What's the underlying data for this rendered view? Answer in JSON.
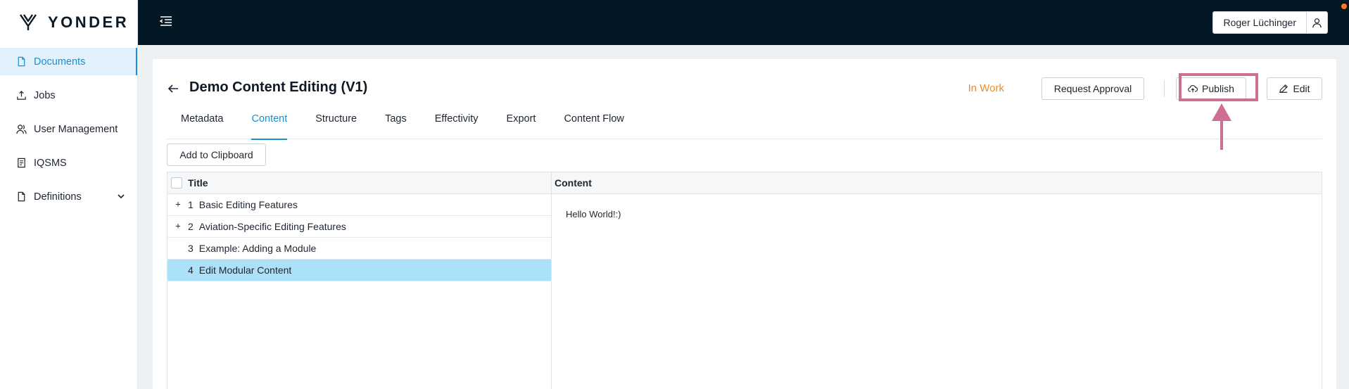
{
  "brand": {
    "name": "YONDER"
  },
  "sidebar": {
    "items": [
      {
        "label": "Documents",
        "icon": "document-icon",
        "active": true
      },
      {
        "label": "Jobs",
        "icon": "upload-icon",
        "active": false
      },
      {
        "label": "User Management",
        "icon": "users-icon",
        "active": false
      },
      {
        "label": "IQSMS",
        "icon": "report-icon",
        "active": false
      },
      {
        "label": "Definitions",
        "icon": "document-icon",
        "active": false,
        "expandable": true
      }
    ]
  },
  "topbar": {
    "user_name": "Roger Lüchinger",
    "notification": true
  },
  "document": {
    "title": "Demo Content Editing (V1)",
    "status": "In Work",
    "request_approval_label": "Request Approval",
    "publish_label": "Publish",
    "edit_label": "Edit"
  },
  "tabs": [
    {
      "label": "Metadata",
      "active": false
    },
    {
      "label": "Content",
      "active": true
    },
    {
      "label": "Structure",
      "active": false
    },
    {
      "label": "Tags",
      "active": false
    },
    {
      "label": "Effectivity",
      "active": false
    },
    {
      "label": "Export",
      "active": false
    },
    {
      "label": "Content Flow",
      "active": false
    }
  ],
  "toolbar": {
    "clipboard_label": "Add to Clipboard"
  },
  "table": {
    "title_header": "Title",
    "content_header": "Content",
    "rows": [
      {
        "num": "1",
        "title": "Basic Editing Features",
        "expandable": true,
        "selected": false
      },
      {
        "num": "2",
        "title": "Aviation-Specific Editing Features",
        "expandable": true,
        "selected": false
      },
      {
        "num": "3",
        "title": "Example: Adding a Module",
        "expandable": false,
        "selected": false
      },
      {
        "num": "4",
        "title": "Edit Modular Content",
        "expandable": false,
        "selected": true
      }
    ],
    "expand_symbol": "+",
    "content_text": "Hello World!:)"
  },
  "colors": {
    "accent": "#1a8fd6",
    "status": "#f08c1e",
    "topbar": "#041725",
    "selected_row": "#ace1fa",
    "annotation": "#cc6f92"
  }
}
